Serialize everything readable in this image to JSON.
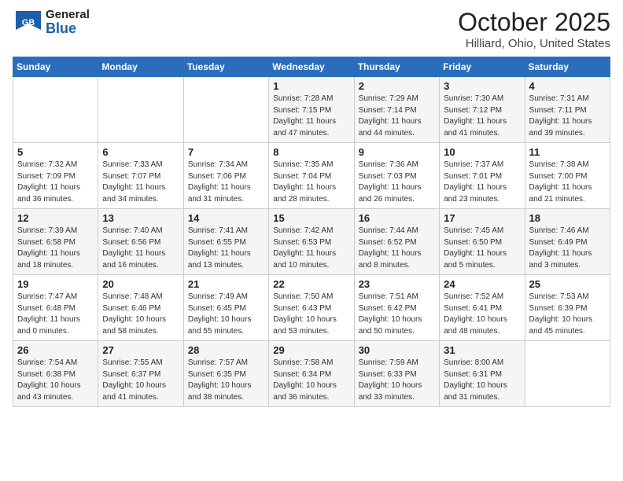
{
  "header": {
    "logo_general": "General",
    "logo_blue": "Blue",
    "month_title": "October 2025",
    "location": "Hilliard, Ohio, United States"
  },
  "weekdays": [
    "Sunday",
    "Monday",
    "Tuesday",
    "Wednesday",
    "Thursday",
    "Friday",
    "Saturday"
  ],
  "weeks": [
    [
      {
        "day": "",
        "info": ""
      },
      {
        "day": "",
        "info": ""
      },
      {
        "day": "",
        "info": ""
      },
      {
        "day": "1",
        "info": "Sunrise: 7:28 AM\nSunset: 7:15 PM\nDaylight: 11 hours\nand 47 minutes."
      },
      {
        "day": "2",
        "info": "Sunrise: 7:29 AM\nSunset: 7:14 PM\nDaylight: 11 hours\nand 44 minutes."
      },
      {
        "day": "3",
        "info": "Sunrise: 7:30 AM\nSunset: 7:12 PM\nDaylight: 11 hours\nand 41 minutes."
      },
      {
        "day": "4",
        "info": "Sunrise: 7:31 AM\nSunset: 7:11 PM\nDaylight: 11 hours\nand 39 minutes."
      }
    ],
    [
      {
        "day": "5",
        "info": "Sunrise: 7:32 AM\nSunset: 7:09 PM\nDaylight: 11 hours\nand 36 minutes."
      },
      {
        "day": "6",
        "info": "Sunrise: 7:33 AM\nSunset: 7:07 PM\nDaylight: 11 hours\nand 34 minutes."
      },
      {
        "day": "7",
        "info": "Sunrise: 7:34 AM\nSunset: 7:06 PM\nDaylight: 11 hours\nand 31 minutes."
      },
      {
        "day": "8",
        "info": "Sunrise: 7:35 AM\nSunset: 7:04 PM\nDaylight: 11 hours\nand 28 minutes."
      },
      {
        "day": "9",
        "info": "Sunrise: 7:36 AM\nSunset: 7:03 PM\nDaylight: 11 hours\nand 26 minutes."
      },
      {
        "day": "10",
        "info": "Sunrise: 7:37 AM\nSunset: 7:01 PM\nDaylight: 11 hours\nand 23 minutes."
      },
      {
        "day": "11",
        "info": "Sunrise: 7:38 AM\nSunset: 7:00 PM\nDaylight: 11 hours\nand 21 minutes."
      }
    ],
    [
      {
        "day": "12",
        "info": "Sunrise: 7:39 AM\nSunset: 6:58 PM\nDaylight: 11 hours\nand 18 minutes."
      },
      {
        "day": "13",
        "info": "Sunrise: 7:40 AM\nSunset: 6:56 PM\nDaylight: 11 hours\nand 16 minutes."
      },
      {
        "day": "14",
        "info": "Sunrise: 7:41 AM\nSunset: 6:55 PM\nDaylight: 11 hours\nand 13 minutes."
      },
      {
        "day": "15",
        "info": "Sunrise: 7:42 AM\nSunset: 6:53 PM\nDaylight: 11 hours\nand 10 minutes."
      },
      {
        "day": "16",
        "info": "Sunrise: 7:44 AM\nSunset: 6:52 PM\nDaylight: 11 hours\nand 8 minutes."
      },
      {
        "day": "17",
        "info": "Sunrise: 7:45 AM\nSunset: 6:50 PM\nDaylight: 11 hours\nand 5 minutes."
      },
      {
        "day": "18",
        "info": "Sunrise: 7:46 AM\nSunset: 6:49 PM\nDaylight: 11 hours\nand 3 minutes."
      }
    ],
    [
      {
        "day": "19",
        "info": "Sunrise: 7:47 AM\nSunset: 6:48 PM\nDaylight: 11 hours\nand 0 minutes."
      },
      {
        "day": "20",
        "info": "Sunrise: 7:48 AM\nSunset: 6:46 PM\nDaylight: 10 hours\nand 58 minutes."
      },
      {
        "day": "21",
        "info": "Sunrise: 7:49 AM\nSunset: 6:45 PM\nDaylight: 10 hours\nand 55 minutes."
      },
      {
        "day": "22",
        "info": "Sunrise: 7:50 AM\nSunset: 6:43 PM\nDaylight: 10 hours\nand 53 minutes."
      },
      {
        "day": "23",
        "info": "Sunrise: 7:51 AM\nSunset: 6:42 PM\nDaylight: 10 hours\nand 50 minutes."
      },
      {
        "day": "24",
        "info": "Sunrise: 7:52 AM\nSunset: 6:41 PM\nDaylight: 10 hours\nand 48 minutes."
      },
      {
        "day": "25",
        "info": "Sunrise: 7:53 AM\nSunset: 6:39 PM\nDaylight: 10 hours\nand 45 minutes."
      }
    ],
    [
      {
        "day": "26",
        "info": "Sunrise: 7:54 AM\nSunset: 6:38 PM\nDaylight: 10 hours\nand 43 minutes."
      },
      {
        "day": "27",
        "info": "Sunrise: 7:55 AM\nSunset: 6:37 PM\nDaylight: 10 hours\nand 41 minutes."
      },
      {
        "day": "28",
        "info": "Sunrise: 7:57 AM\nSunset: 6:35 PM\nDaylight: 10 hours\nand 38 minutes."
      },
      {
        "day": "29",
        "info": "Sunrise: 7:58 AM\nSunset: 6:34 PM\nDaylight: 10 hours\nand 36 minutes."
      },
      {
        "day": "30",
        "info": "Sunrise: 7:59 AM\nSunset: 6:33 PM\nDaylight: 10 hours\nand 33 minutes."
      },
      {
        "day": "31",
        "info": "Sunrise: 8:00 AM\nSunset: 6:31 PM\nDaylight: 10 hours\nand 31 minutes."
      },
      {
        "day": "",
        "info": ""
      }
    ]
  ]
}
